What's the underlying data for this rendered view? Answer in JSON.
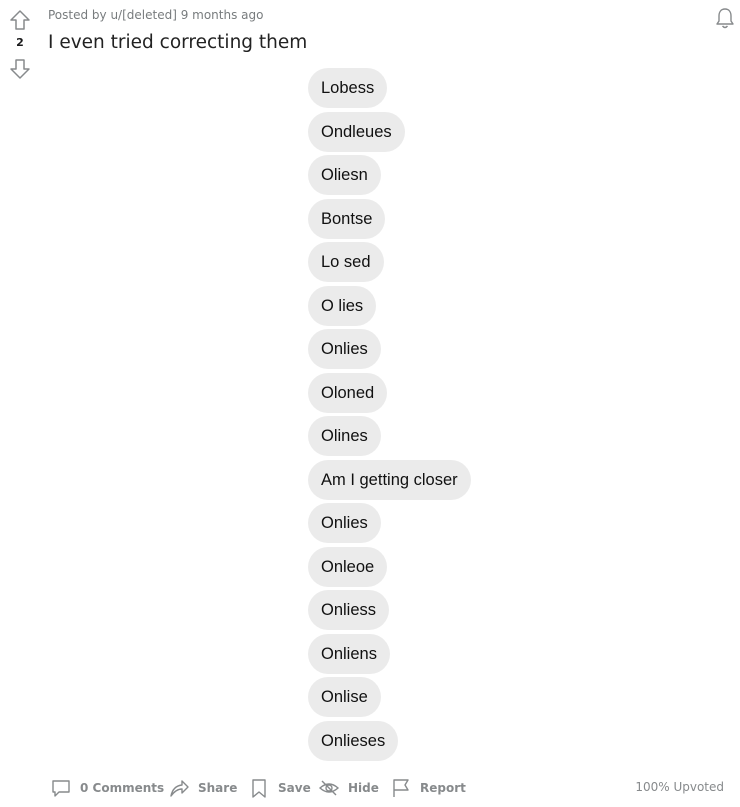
{
  "post": {
    "score": "2",
    "meta": "Posted by u/[deleted] 9 months ago",
    "title": "I even tried correcting them"
  },
  "messages": [
    "Lobess",
    "Ondleues",
    "Oliesn",
    "Bontse",
    "Lo sed",
    "O lies",
    "Onlies",
    "Oloned",
    "Olines",
    "Am I getting closer",
    "Onlies",
    "Onleoe",
    "Onliess",
    "Onliens",
    "Onlise",
    "Onlieses"
  ],
  "actions": {
    "comments": "0 Comments",
    "share": "Share",
    "save": "Save",
    "hide": "Hide",
    "report": "Report",
    "upvoted": "100% Upvoted"
  },
  "icons": {
    "upvote": "upvote-arrow-icon",
    "downvote": "downvote-arrow-icon",
    "notify": "bell-icon",
    "comments": "comment-bubble-icon",
    "share": "share-arrow-icon",
    "save": "bookmark-icon",
    "hide": "eye-slash-icon",
    "report": "flag-icon"
  },
  "colors": {
    "bubble": "#ebebeb",
    "muted": "#878a8c"
  }
}
